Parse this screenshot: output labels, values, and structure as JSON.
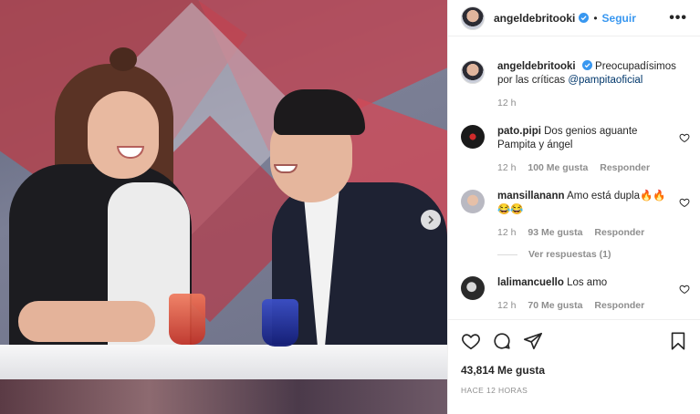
{
  "post": {
    "author": "angeldebritooki",
    "follow_label": "Seguir",
    "more_label": "•••",
    "caption": {
      "author": "angeldebritooki",
      "text": "Preocupadísimos por las críticas",
      "mention": "@pampitaoficial",
      "time": "12 h"
    },
    "likes": "43,814 Me gusta",
    "timestamp": "HACE 12 HORAS"
  },
  "comments": [
    {
      "user": "pato.pipi",
      "text": "Dos genios aguante Pampita y ángel",
      "time": "12 h",
      "likes": "100 Me gusta",
      "reply": "Responder"
    },
    {
      "user": "mansillanann",
      "text": "Amo está dupla🔥🔥😂😂",
      "time": "12 h",
      "likes": "93 Me gusta",
      "reply": "Responder",
      "view_replies": "Ver respuestas (1)"
    },
    {
      "user": "lalimancuello",
      "text": "Los amo",
      "time": "12 h",
      "likes": "70 Me gusta",
      "reply": "Responder"
    }
  ],
  "icons": {
    "like": "heart-icon",
    "comment": "comment-icon",
    "share": "share-icon",
    "save": "bookmark-icon",
    "next": "chevron-right-icon",
    "verified": "verified-badge-icon"
  },
  "colors": {
    "link_blue": "#3897f0",
    "muted": "#8e8e8e",
    "text": "#262626"
  }
}
